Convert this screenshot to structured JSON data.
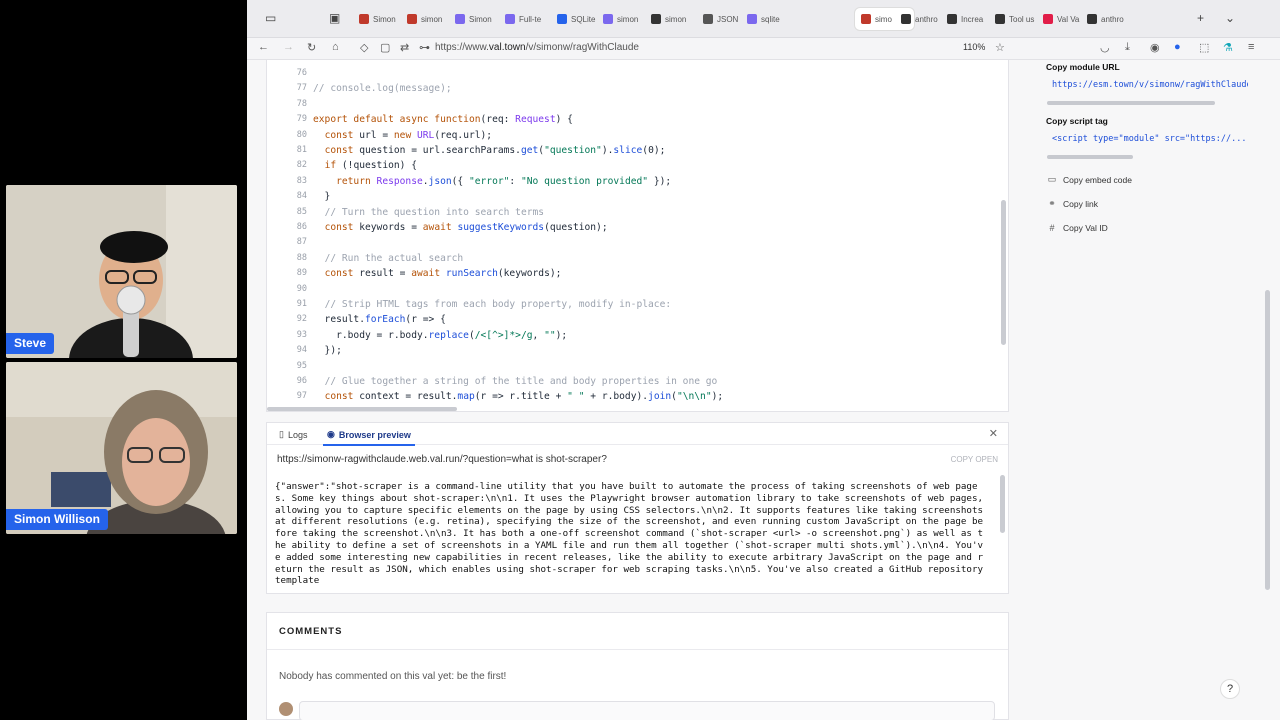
{
  "participants": [
    {
      "name": "Steve"
    },
    {
      "name": "Simon Willison"
    }
  ],
  "browser": {
    "tabs": [
      {
        "label": "Simon"
      },
      {
        "label": "simon"
      },
      {
        "label": "Simon"
      },
      {
        "label": "Full-te"
      },
      {
        "label": "SQLite"
      },
      {
        "label": "simon"
      },
      {
        "label": "simon"
      },
      {
        "label": "JSON"
      },
      {
        "label": "sqlite"
      },
      {
        "label": "simo"
      },
      {
        "label": "anthro"
      },
      {
        "label": "Increa"
      },
      {
        "label": "Tool us"
      },
      {
        "label": "Val Va"
      },
      {
        "label": "anthro"
      }
    ],
    "url_prefix": "https://www.",
    "url_host": "val.town",
    "url_path": "/v/simonw/ragWithClaude",
    "zoom": "110%"
  },
  "editor": {
    "lines": [
      {
        "n": "76",
        "html": ""
      },
      {
        "n": "77",
        "html": "<span class='cm'>// console.log(message);</span>"
      },
      {
        "n": "78",
        "html": ""
      },
      {
        "n": "79",
        "html": "<span class='kw'>export default async function</span>(req: <span class='ty'>Request</span>) {"
      },
      {
        "n": "80",
        "html": "  <span class='kw'>const</span> url = <span class='kw'>new</span> <span class='ty'>URL</span>(req.url);"
      },
      {
        "n": "81",
        "html": "  <span class='kw'>const</span> question = url.searchParams.<span class='fn'>get</span>(<span class='str'>\"question\"</span>).<span class='fn'>slice</span>(0);"
      },
      {
        "n": "82",
        "html": "  <span class='kw'>if</span> (!question) {"
      },
      {
        "n": "83",
        "html": "    <span class='kw'>return</span> <span class='ty'>Response</span>.<span class='fn'>json</span>({ <span class='str'>\"error\"</span>: <span class='str'>\"No question provided\"</span> });"
      },
      {
        "n": "84",
        "html": "  }"
      },
      {
        "n": "85",
        "html": "  <span class='cm'>// Turn the question into search terms</span>"
      },
      {
        "n": "86",
        "html": "  <span class='kw'>const</span> keywords = <span class='kw'>await</span> <span class='fn'>suggestKeywords</span>(question);"
      },
      {
        "n": "87",
        "html": ""
      },
      {
        "n": "88",
        "html": "  <span class='cm'>// Run the actual search</span>"
      },
      {
        "n": "89",
        "html": "  <span class='kw'>const</span> result = <span class='kw'>await</span> <span class='fn'>runSearch</span>(keywords);"
      },
      {
        "n": "90",
        "html": ""
      },
      {
        "n": "91",
        "html": "  <span class='cm'>// Strip HTML tags from each body property, modify in-place:</span>"
      },
      {
        "n": "92",
        "html": "  result.<span class='fn'>forEach</span>(r =&gt; {"
      },
      {
        "n": "93",
        "html": "    r.body = r.body.<span class='fn'>replace</span>(<span class='str'>/&lt;[^&gt;]*&gt;/g</span>, <span class='str'>\"\"</span>);"
      },
      {
        "n": "94",
        "html": "  });"
      },
      {
        "n": "95",
        "html": ""
      },
      {
        "n": "96",
        "html": "  <span class='cm'>// Glue together a string of the title and body properties in one go</span>"
      },
      {
        "n": "97",
        "html": "  <span class='kw'>const</span> context = result.<span class='fn'>map</span>(r =&gt; r.title + <span class='str'>\" \"</span> + r.body).<span class='fn'>join</span>(<span class='str'>\"\\n\\n\"</span>);"
      }
    ]
  },
  "sidebar": {
    "module_url_label": "Copy module URL",
    "module_url": "https://esm.town/v/simonw/ragWithClaude",
    "script_tag_label": "Copy script tag",
    "script_tag": "<script type=\"module\" src=\"https://...",
    "embed_label": "Copy embed code",
    "link_label": "Copy link",
    "id_label": "Copy Val ID"
  },
  "preview": {
    "tab_logs": "Logs",
    "tab_browser": "Browser preview",
    "url": "https://simonw-ragwithclaude.web.val.run/?question=what is shot-scraper?",
    "copy_open": "COPY  OPEN",
    "body": "{\"answer\":\"shot-scraper is a command-line utility that you have built to automate the process of taking screenshots of web pages. Some key things about shot-scraper:\\n\\n1. It uses the Playwright browser automation library to take screenshots of web pages, allowing you to capture specific elements on the page by using CSS selectors.\\n\\n2. It supports features like taking screenshots at different resolutions (e.g. retina), specifying the size of the screenshot, and even running custom JavaScript on the page before taking the screenshot.\\n\\n3. It has both a one-off screenshot command (`shot-scraper <url> -o screenshot.png`) as well as the ability to define a set of screenshots in a YAML file and run them all together (`shot-scraper multi shots.yml`).\\n\\n4. You've added some interesting new capabilities in recent releases, like the ability to execute arbitrary JavaScript on the page and return the result as JSON, which enables using shot-scraper for web scraping tasks.\\n\\n5. You've also created a GitHub repository template"
  },
  "comments": {
    "title": "COMMENTS",
    "empty": "Nobody has commented on this val yet: be the first!"
  },
  "help_label": "?"
}
